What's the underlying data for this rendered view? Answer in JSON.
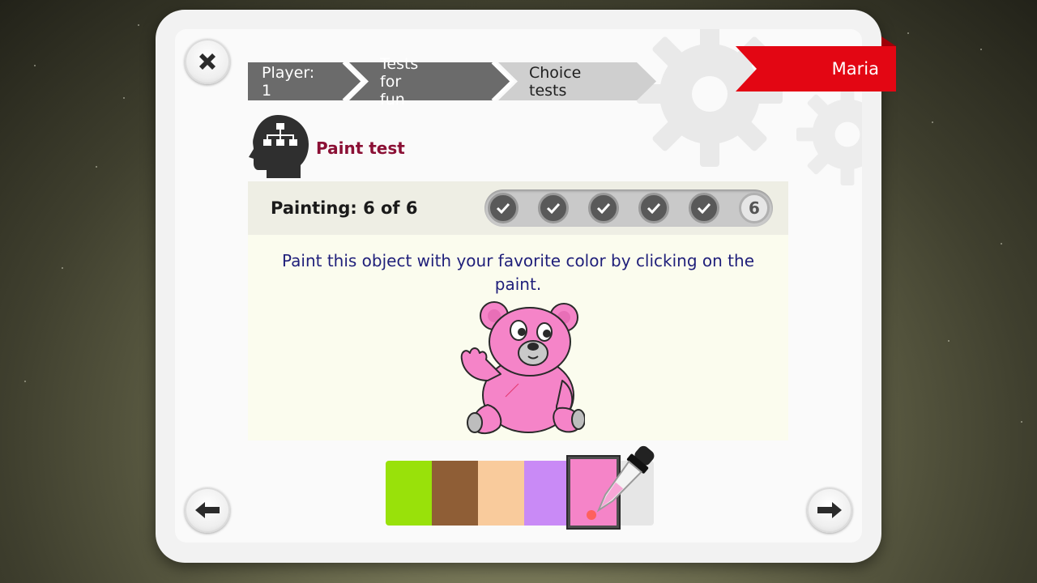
{
  "nav": {
    "close_icon": "close-x-icon",
    "back_icon": "arrow-left-icon",
    "next_icon": "arrow-right-icon"
  },
  "breadcrumb": [
    {
      "label": "Player: 1"
    },
    {
      "label": "Tests for fun"
    },
    {
      "label": "Choice tests"
    }
  ],
  "profile": {
    "name": "Maria"
  },
  "test": {
    "title": "Paint test",
    "icon": "head-hierarchy-icon"
  },
  "progress": {
    "label": "Painting: 6 of 6",
    "completed_steps": 5,
    "current_step": "6",
    "total_steps": 6
  },
  "instruction": "Paint this object with your favorite color by clicking on the paint.",
  "object": {
    "name": "teddy-bear",
    "fill_color": "#f584c8"
  },
  "palette": {
    "colors": [
      "#99e10a",
      "#8f5e36",
      "#f9cb9c",
      "#c98af6",
      "#f584c8",
      "#e6e6e6"
    ],
    "selected_index": 4
  },
  "colors": {
    "ribbon": "#e30613",
    "title": "#8b1035",
    "instruction": "#1f1f7a"
  }
}
